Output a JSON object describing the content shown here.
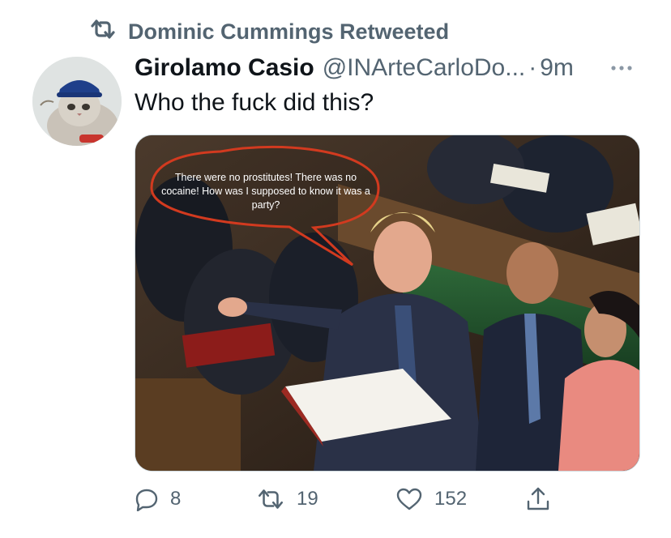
{
  "retweet": {
    "label": "Dominic Cummings Retweeted",
    "icon": "retweet-icon"
  },
  "tweet": {
    "author_name": "Girolamo Casio",
    "author_handle": "@INArteCarloDo...",
    "separator": "·",
    "time": "9m",
    "text": "Who the fuck did this?",
    "avatar": "cat-with-hat-avatar",
    "media": {
      "speech_bubble": "There were no prostitutes! There was no cocaine! How was I supposed to know it was a party?"
    }
  },
  "actions": {
    "replies": "8",
    "retweets": "19",
    "likes": "152"
  },
  "colors": {
    "text_primary": "#0f1419",
    "text_secondary": "#536471",
    "bubble_stroke": "#d23a1f"
  }
}
